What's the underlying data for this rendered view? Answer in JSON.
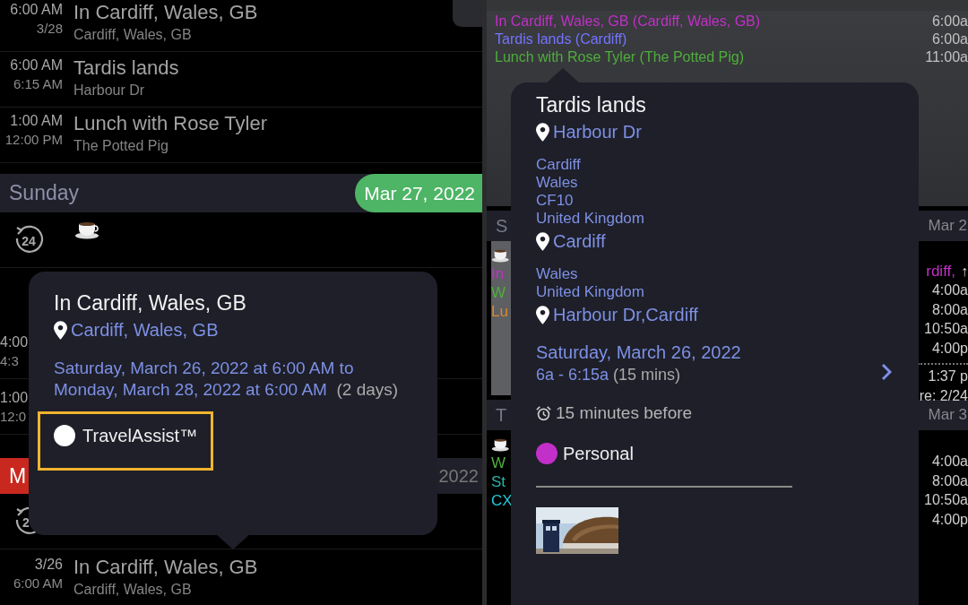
{
  "left": {
    "top_events": [
      {
        "time1": "6:00 AM",
        "time2": "3/28",
        "title": "In Cardiff, Wales, GB",
        "subtitle": "Cardiff, Wales, GB"
      },
      {
        "time1": "6:00 AM",
        "time2": "6:15 AM",
        "title": "Tardis lands",
        "subtitle": "Harbour Dr"
      },
      {
        "time1": "1:00 AM",
        "time2": "12:00 PM",
        "title": "Lunch with Rose Tyler",
        "subtitle": "The Potted Pig"
      }
    ],
    "day_header": {
      "label": "Sunday",
      "date": "Mar 27, 2022",
      "color": "#4db565"
    },
    "cycle_label": "24",
    "hidden_rows": [
      {
        "time1": "4:00",
        "time2": "4:3"
      },
      {
        "time1": "1:00",
        "time2": "12:0"
      }
    ],
    "day_header_2": {
      "label": "M",
      "date": "2022",
      "color": "#c9281f"
    },
    "cycle_label_2": "2",
    "bottom_event": {
      "time1": "3/26",
      "time2": "6:00 AM",
      "title": "In Cardiff, Wales, GB",
      "subtitle": "Cardiff, Wales, GB"
    },
    "popover": {
      "title": "In Cardiff, Wales, GB",
      "location": "Cardiff, Wales, GB",
      "dates": "Saturday, March 26, 2022 at 6:00 AM  to Monday, March 28, 2022 at 6:00 AM",
      "duration": "(2 days)",
      "calendar": {
        "name": "TravelAssist™",
        "color": "#ffffff",
        "highlighted": true
      }
    }
  },
  "right": {
    "top_events": [
      {
        "text": "In Cardiff, Wales, GB (Cardiff, Wales, GB)",
        "time": "6:00a",
        "color": "#c22fc9"
      },
      {
        "text": "Tardis lands (Cardiff)",
        "time": "6:00a",
        "color": "#7474ff"
      },
      {
        "text": "Lunch with Rose Tyler (The Potted Pig)",
        "time": "11:00a",
        "color": "#4fae3c"
      }
    ],
    "days": [
      {
        "label": "S",
        "date": "Mar 2",
        "highlighted": true,
        "left_items": [
          {
            "kind": "coffee"
          },
          {
            "kind": "text",
            "text": "In",
            "color": "#c22fc9"
          },
          {
            "kind": "text",
            "text": "W",
            "color": "#4fae3c"
          },
          {
            "kind": "text",
            "text": "Lu",
            "color": "#d9892a"
          }
        ],
        "right_items": [
          {
            "kind": "event",
            "text": "rdiff,",
            "extra": "↑",
            "color": "#c22fc9"
          },
          {
            "kind": "time",
            "text": "4:00a"
          },
          {
            "kind": "time",
            "text": "8:00a"
          },
          {
            "kind": "time",
            "text": "10:50a"
          },
          {
            "kind": "time",
            "text": "4:00p"
          },
          {
            "kind": "dots"
          },
          {
            "kind": "time",
            "text": "1:37 p"
          },
          {
            "kind": "time",
            "text": "re: 2/24"
          }
        ]
      },
      {
        "label": "T",
        "date": "Mar 3",
        "highlighted": false,
        "left_items": [
          {
            "kind": "coffee"
          },
          {
            "kind": "text",
            "text": "W",
            "color": "#4fae3c"
          },
          {
            "kind": "text",
            "text": "St",
            "color": "#2ab3a8"
          },
          {
            "kind": "text",
            "text": "CX",
            "color": "#22c8d8"
          }
        ],
        "right_items": [
          {
            "kind": "time",
            "text": "4:00a"
          },
          {
            "kind": "time",
            "text": "8:00a"
          },
          {
            "kind": "time",
            "text": "10:50a"
          },
          {
            "kind": "time",
            "text": "4:00p"
          }
        ]
      }
    ],
    "popover": {
      "title": "Tardis lands",
      "location": "Harbour Dr",
      "addresses": [
        {
          "lines": [
            "Cardiff",
            "Wales",
            "CF10",
            "United Kingdom"
          ],
          "place": "Cardiff"
        },
        {
          "lines": [
            "Wales",
            "United Kingdom"
          ],
          "place": "Harbour Dr,Cardiff"
        }
      ],
      "date": "Saturday, March 26, 2022",
      "time": "6a - 6:15a",
      "duration": "(15 mins)",
      "alarm": "15 minutes before",
      "calendar": {
        "name": "Personal",
        "color": "#c22fc9"
      }
    }
  }
}
